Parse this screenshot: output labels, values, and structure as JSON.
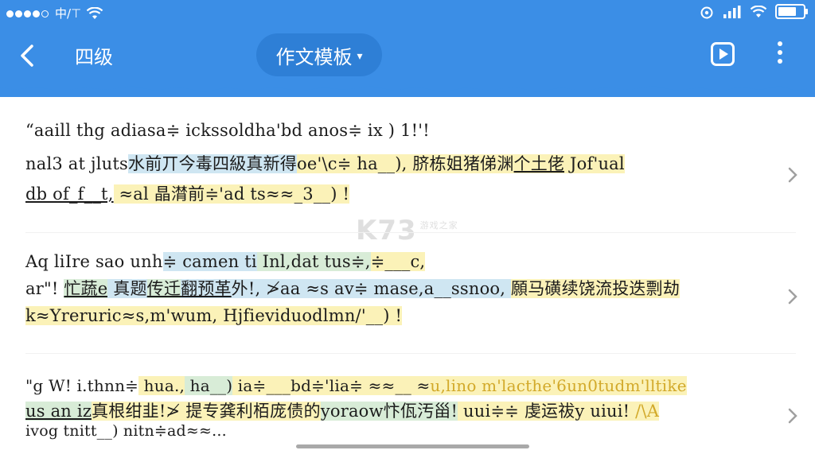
{
  "status_bar": {
    "carrier": "中/⊤",
    "icons": [
      "signal-dots-icon",
      "wifi-icon",
      "alarm-icon",
      "cellular-icon",
      "wifi-icon",
      "battery-icon"
    ]
  },
  "nav": {
    "back_icon": "chevron-left-icon",
    "title": "四级",
    "dropdown_label": "作文模板",
    "play_icon": "play-square-icon",
    "more_icon": "more-vertical-icon"
  },
  "watermark": {
    "logo": "K73",
    "tagline": "游戏之家",
    "domain": ".com"
  },
  "colors": {
    "header": "#3b8ee6",
    "dropdown": "#2e7fd6",
    "highlight_yellow": "#fbf2b8",
    "highlight_blue": "#cfe6f2",
    "highlight_green": "#d8ecd7"
  },
  "items": [
    {
      "line1": "“aaill thg adiasa≑ ickssoldha'bd anos≑ ix ) 1!'!",
      "line2_a": "nal3 at jluts",
      "line2_b": "水前丌今毒四級真新得",
      "line2_c": "oe'\\c≑ ha__), ",
      "line2_d": "脐栋姐猪俤渊",
      "line2_e": "个土佬",
      "line2_f": " Jof'ual",
      "line3_a": "db of_f__t,",
      "line3_b": " ≈al 晶潸前≑'ad ts≈≈_3__) !"
    },
    {
      "line1_a": "Aq liIre sao unh",
      "line1_b": "≑ camen ti",
      "line1_c": " Inl,dat tus≑,",
      "line1_d": "≑___c,",
      "line2_a": "ar\"! ",
      "line2_b": "忙蔬e",
      "line2_c": " 真题",
      "line2_d": "传迁",
      "line2_e": "翻预革",
      "line2_f": "外!, ≯aa ≈s av≑ mase,a__ssnoo, ",
      "line2_g": "願马磺续饶流投迭剽劫",
      "line3": "k≈Yreruric≈s,m'wum, Hjfieviduodlmn/'__) !"
    },
    {
      "line1_a": "\"g W! i.thnn≑",
      "line1_b": " hua.,",
      "line1_c": " ha__)",
      "line1_d": " ia≑___bd≑'lia≑ ≈≈__ ≈",
      "line1_e": "u,lino m'lacthe'6un0tudm'lltike",
      "line2_a": "us an iz",
      "line2_b": "真根绀韭!≯ 提专龚利栢庞债的",
      "line2_c": "yoraow忭佤汚甾!",
      "line2_d": " uui≑≑ 虔运祓y uiui! ",
      "line2_e": "/\\A",
      "line3": "ivog tnitt__) nitn≑ad≈≈..."
    }
  ]
}
